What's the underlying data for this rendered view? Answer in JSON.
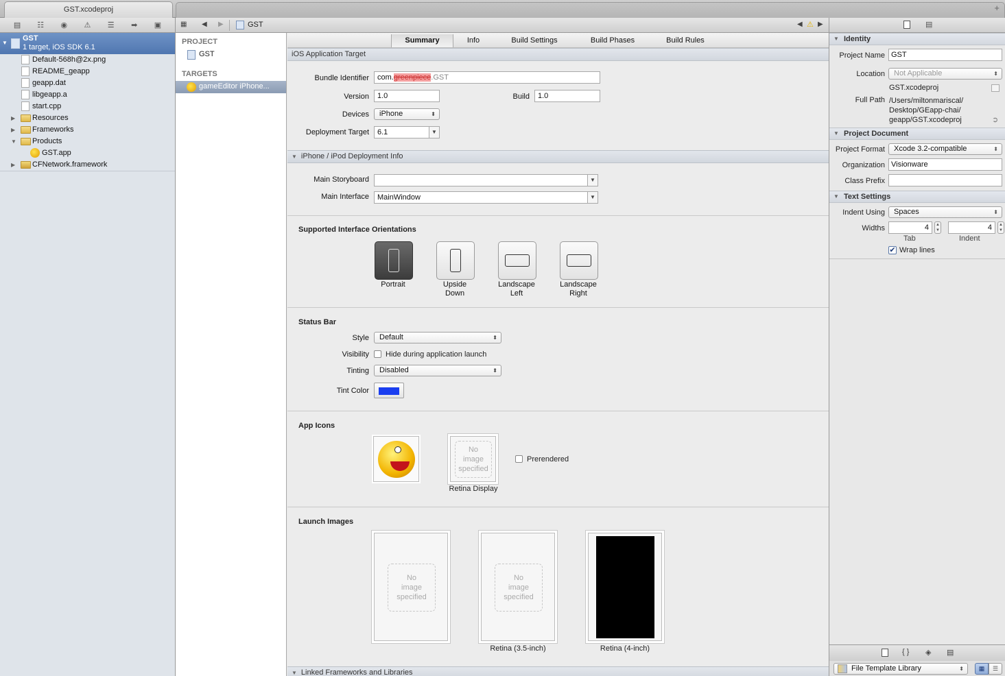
{
  "window": {
    "tab_title": "GST.xcodeproj",
    "plus": "+"
  },
  "navigator": {
    "project": {
      "name": "GST",
      "subtitle": "1 target, iOS SDK 6.1"
    },
    "files": [
      {
        "label": "Default-568h@2x.png",
        "type": "file"
      },
      {
        "label": "README_geapp",
        "type": "file"
      },
      {
        "label": "geapp.dat",
        "type": "file"
      },
      {
        "label": "libgeapp.a",
        "type": "file"
      },
      {
        "label": "start.cpp",
        "type": "file"
      },
      {
        "label": "Resources",
        "type": "folder"
      },
      {
        "label": "Frameworks",
        "type": "folder"
      },
      {
        "label": "Products",
        "type": "folder"
      },
      {
        "label": "GST.app",
        "type": "app"
      },
      {
        "label": "CFNetwork.framework",
        "type": "framework"
      }
    ]
  },
  "jumpbar": {
    "crumb": "GST"
  },
  "ptlist": {
    "project_header": "PROJECT",
    "project_item": "GST",
    "targets_header": "TARGETS",
    "target_item": "gameEditor iPhone..."
  },
  "tabs": [
    "Summary",
    "Info",
    "Build Settings",
    "Build Phases",
    "Build Rules"
  ],
  "ios_target": {
    "section": "iOS Application Target",
    "bundle_label": "Bundle Identifier",
    "bundle_value_prefix": "com.",
    "bundle_value_redacted": "greenpiece",
    "bundle_value_suffix": ".GST",
    "version_label": "Version",
    "version": "1.0",
    "build_label": "Build",
    "build": "1.0",
    "devices_label": "Devices",
    "devices": "iPhone",
    "deploy_label": "Deployment Target",
    "deploy": "6.1"
  },
  "deploy_info": {
    "section": "iPhone / iPod Deployment Info",
    "storyboard_label": "Main Storyboard",
    "storyboard": "",
    "interface_label": "Main Interface",
    "interface": "MainWindow"
  },
  "orientations": {
    "title": "Supported Interface Orientations",
    "items": [
      {
        "line1": "Portrait",
        "line2": "",
        "selected": true
      },
      {
        "line1": "Upside",
        "line2": "Down",
        "selected": false
      },
      {
        "line1": "Landscape",
        "line2": "Left",
        "selected": false
      },
      {
        "line1": "Landscape",
        "line2": "Right",
        "selected": false
      }
    ]
  },
  "status_bar": {
    "title": "Status Bar",
    "style_label": "Style",
    "style": "Default",
    "visibility_label": "Visibility",
    "visibility_option": "Hide during application launch",
    "tinting_label": "Tinting",
    "tinting": "Disabled",
    "tint_label": "Tint Color",
    "tint_color": "#1a3ef0"
  },
  "app_icons": {
    "title": "App Icons",
    "no_image_1": "No",
    "no_image_2": "image",
    "no_image_3": "specified",
    "retina_label": "Retina Display",
    "prerendered": "Prerendered"
  },
  "launch_images": {
    "title": "Launch Images",
    "no_image_1": "No",
    "no_image_2": "image",
    "no_image_3": "specified",
    "retina35": "Retina (3.5-inch)",
    "retina4": "Retina (4-inch)"
  },
  "linked": {
    "section": "Linked Frameworks and Libraries"
  },
  "inspector": {
    "identity": "Identity",
    "project_name_label": "Project Name",
    "project_name": "GST",
    "location_label": "Location",
    "location": "Not Applicable",
    "file_name": "GST.xcodeproj",
    "full_path_label": "Full Path",
    "full_path_1": "/Users/miltonmariscal/",
    "full_path_2": "Desktop/GEapp-chai/",
    "full_path_3": "geapp/GST.xcodeproj",
    "project_document": "Project Document",
    "format_label": "Project Format",
    "format": "Xcode 3.2-compatible",
    "org_label": "Organization",
    "org": "Visionware",
    "prefix_label": "Class Prefix",
    "prefix": "",
    "text_settings": "Text Settings",
    "indent_label": "Indent Using",
    "indent": "Spaces",
    "widths_label": "Widths",
    "tab_width": "4",
    "indent_width": "4",
    "tab_caption": "Tab",
    "indent_caption": "Indent",
    "wrap": "Wrap lines"
  },
  "library": {
    "selector": "File Template Library"
  }
}
